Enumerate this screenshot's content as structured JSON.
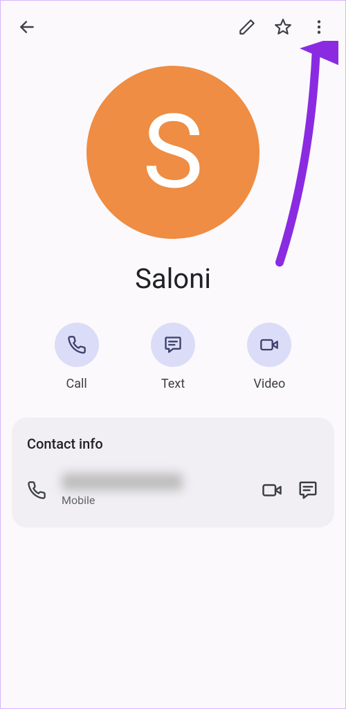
{
  "colors": {
    "avatar_bg": "#ee8d43",
    "action_circle_bg": "#dbdcf7",
    "action_icon": "#3d3f6b",
    "annotation_arrow": "#8a2be2"
  },
  "contact": {
    "initial": "S",
    "name": "Saloni"
  },
  "actions": {
    "call": "Call",
    "text": "Text",
    "video": "Video"
  },
  "contact_info": {
    "title": "Contact info",
    "phone_type": "Mobile",
    "phone_number_redacted": true
  }
}
